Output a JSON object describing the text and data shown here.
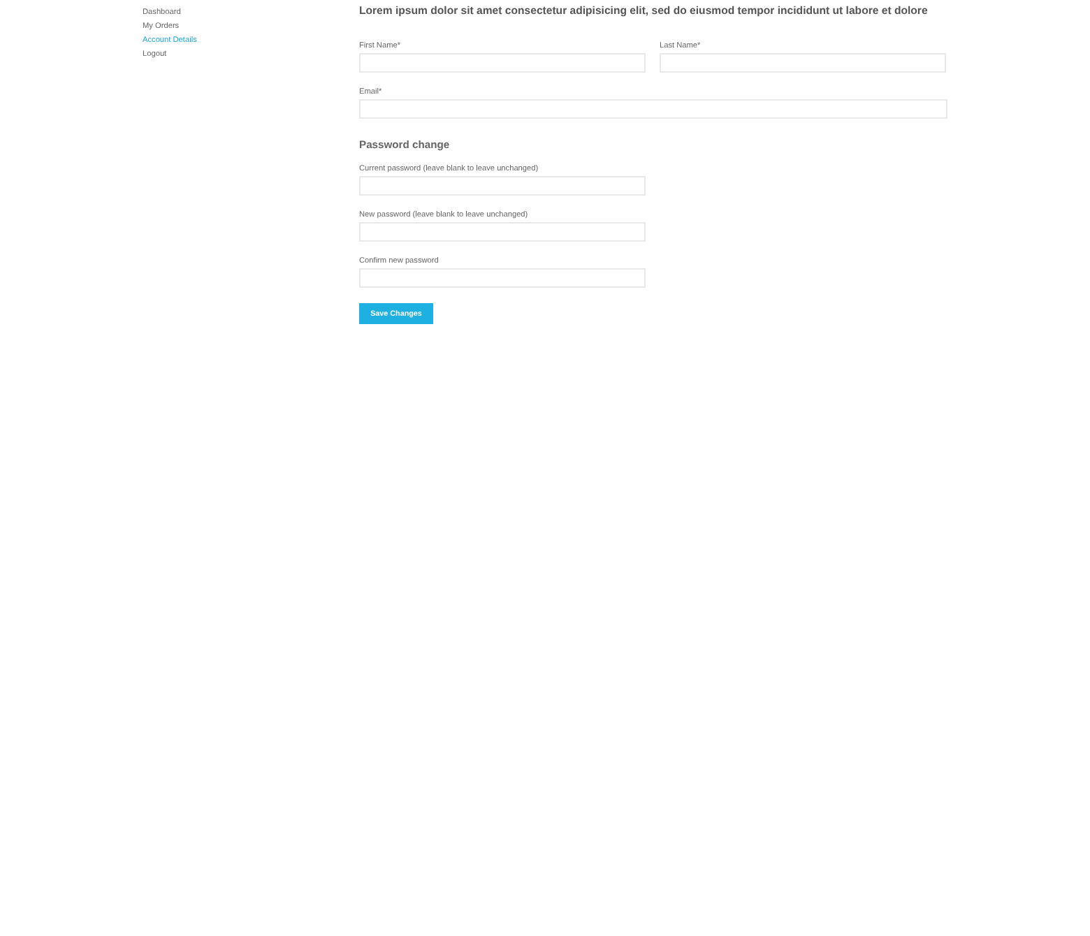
{
  "sidebar": {
    "items": [
      {
        "label": "Dashboard",
        "selected": false
      },
      {
        "label": "My Orders",
        "selected": false
      },
      {
        "label": "Account Details",
        "selected": true
      },
      {
        "label": "Logout",
        "selected": false
      }
    ]
  },
  "main": {
    "heading": "Lorem ipsum dolor sit amet consectetur adipisicing elit, sed do eiusmod tempor incididunt ut labore et dolore",
    "name_fields": [
      {
        "label": "First Name*"
      },
      {
        "label": "Last Name*"
      }
    ],
    "email_field": {
      "label": "Email*"
    },
    "password_section": {
      "heading": "Password change",
      "fields": [
        {
          "label": "Current password (leave blank to leave unchanged)"
        },
        {
          "label": "New password (leave blank to leave unchanged)"
        },
        {
          "label": "Confirm new password"
        }
      ]
    },
    "save_button": "Save Changes"
  }
}
